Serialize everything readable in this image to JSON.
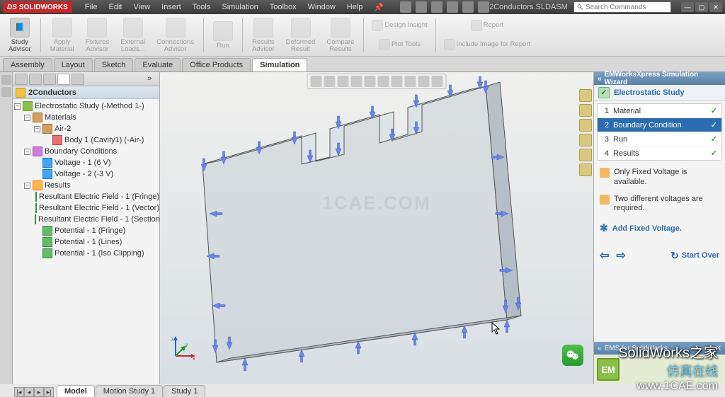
{
  "app": {
    "brand": "SOLIDWORKS",
    "doc_name": "2Conductors.SLDASM",
    "search_placeholder": "Search Commands"
  },
  "menus": [
    "File",
    "Edit",
    "View",
    "Insert",
    "Tools",
    "Simulation",
    "Toolbox",
    "Window",
    "Help"
  ],
  "ribbon": {
    "study_advisor": "Study\nAdvisor",
    "apply_material": "Apply\nMaterial",
    "fixtures_advisor": "Fixtures\nAdvisor",
    "external_loads": "External\nLoads...",
    "connections_advisor": "Connections\nAdvisor",
    "run": "Run",
    "results_advisor": "Results\nAdvisor",
    "deformed_result": "Deformed\nResult",
    "compare_results": "Compare\nResults",
    "design_insight": "Design Insight",
    "plot_tools": "Plot Tools",
    "report": "Report",
    "include_image": "Include Image for Report"
  },
  "tabs": [
    "Assembly",
    "Layout",
    "Sketch",
    "Evaluate",
    "Office Products",
    "Simulation"
  ],
  "active_tab": "Simulation",
  "tree": {
    "root": "2Conductors",
    "study": "Electrostatic Study (-Method 1-)",
    "materials": "Materials",
    "air": "Air-2",
    "body": "Body 1 (Cavity1) (-Air-)",
    "bc": "Boundary Conditions",
    "v1": "Voltage - 1 (6 V)",
    "v2": "Voltage - 2 (-3 V)",
    "results": "Results",
    "r1": "Resultant Electric Field - 1 (Fringe)",
    "r2": "Resultant Electric Field - 1 (Vector)",
    "r3": "Resultant Electric Field - 1 (Section)",
    "r4": "Potential - 1 (Fringe)",
    "r5": "Potential - 1 (Lines)",
    "r6": "Potential - 1 (Iso Clipping)"
  },
  "watermark": "1CAE.COM",
  "wizard": {
    "title": "EMWorksXpress Simulation Wizard",
    "subtitle": "Electrostatic Study",
    "steps": [
      {
        "n": "1",
        "label": "Material"
      },
      {
        "n": "2",
        "label": "Boundary Condition"
      },
      {
        "n": "3",
        "label": "Run"
      },
      {
        "n": "4",
        "label": "Results"
      }
    ],
    "active_step": 1,
    "note1": "Only Fixed Voltage is available.",
    "note2": "Two different voltages are required.",
    "add": "Add Fixed Voltage.",
    "start_over": "Start Over",
    "ems_title": "EMS for SolidWorks",
    "em_logo": "EM"
  },
  "bottom_tabs": [
    "Model",
    "Motion Study 1",
    "Study 1"
  ],
  "active_bottom": "Model",
  "overlay": {
    "l1": "SolidWorks之家",
    "l2": "仿真在线",
    "l3": "www.1CAE.com"
  }
}
